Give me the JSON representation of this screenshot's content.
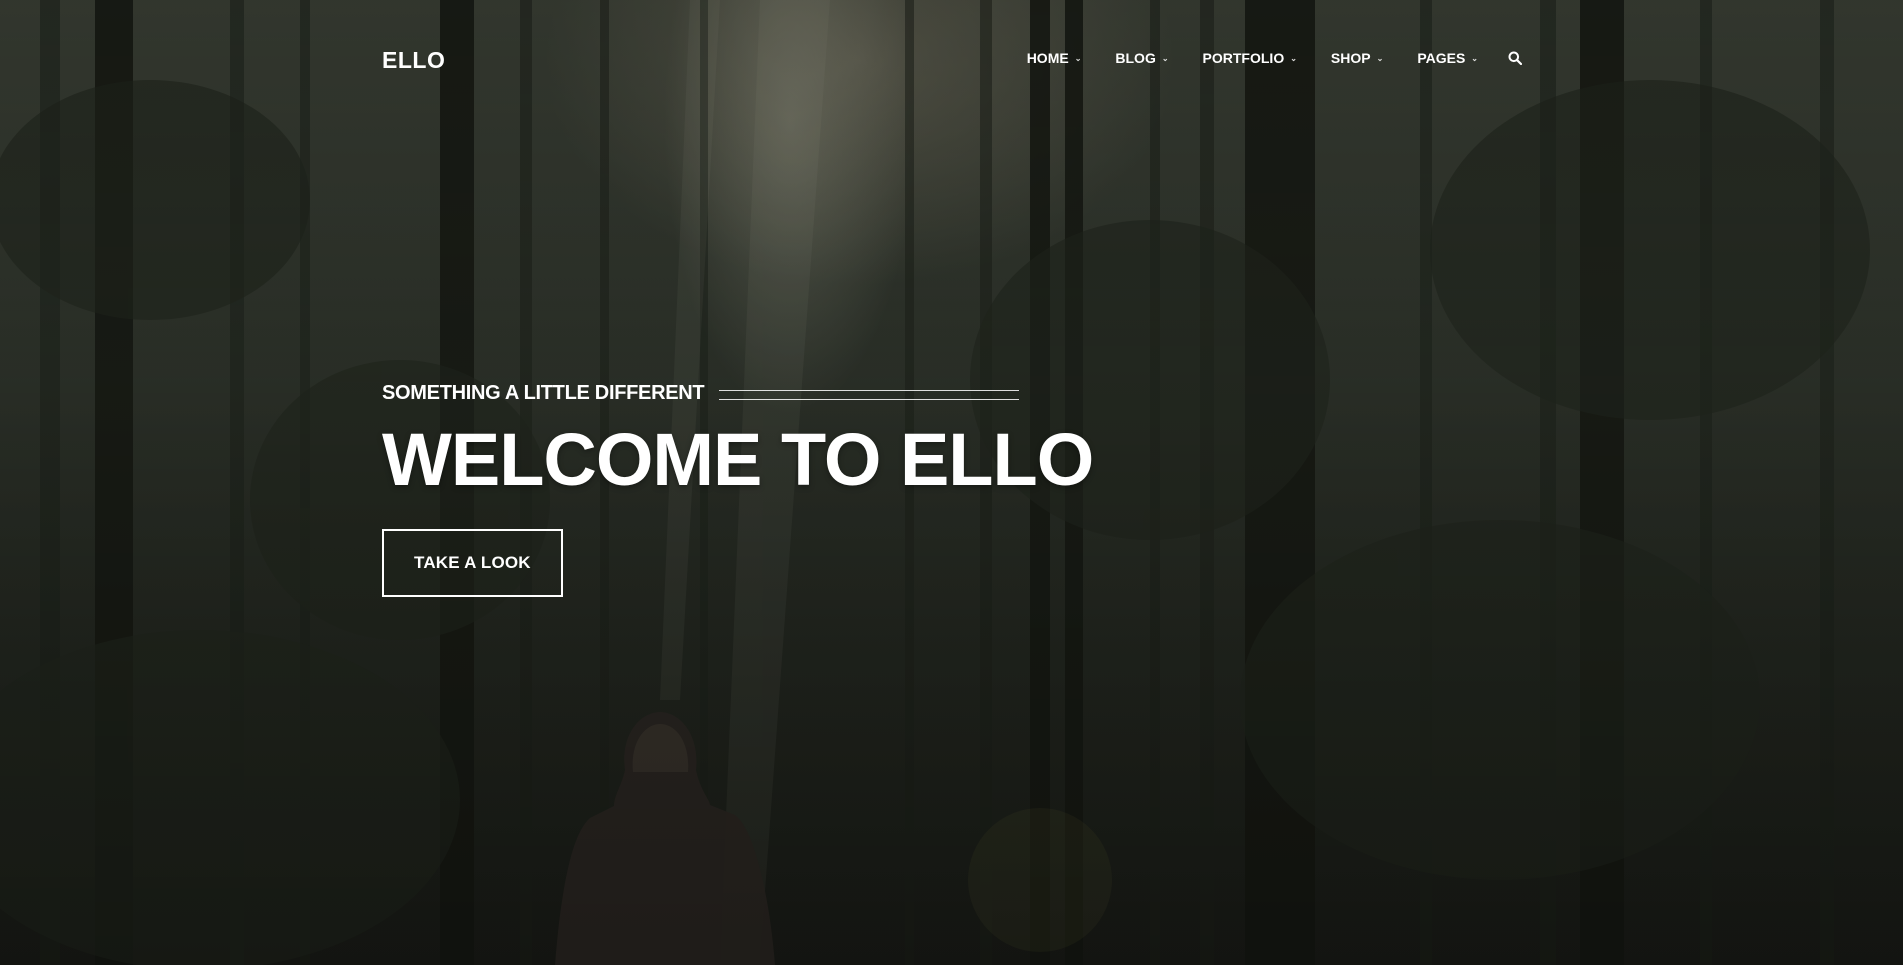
{
  "header": {
    "logo": "ELLO",
    "nav": [
      {
        "label": "HOME"
      },
      {
        "label": "BLOG"
      },
      {
        "label": "PORTFOLIO"
      },
      {
        "label": "SHOP"
      },
      {
        "label": "PAGES"
      }
    ],
    "search_icon": "search-icon"
  },
  "hero": {
    "subtitle": "SOMETHING A LITTLE DIFFERENT",
    "title": "WELCOME TO ELLO",
    "button_label": "TAKE A LOOK"
  },
  "colors": {
    "text": "#ffffff",
    "background": "#22261f"
  }
}
